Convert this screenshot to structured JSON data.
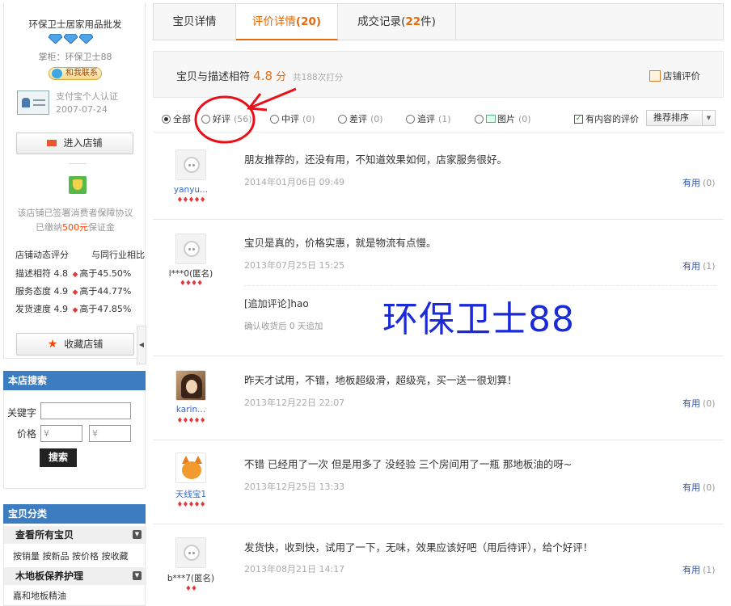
{
  "shop": {
    "name": "环保卫士居家用品批发",
    "keeper": "掌柜：环保卫士88",
    "contact": "和我联系",
    "cert_line1": "支付宝个人认证",
    "cert_line2": "2007-07-24",
    "enter_button": "进入店铺",
    "protect_line1": "该店铺已签署消费者保障协议",
    "protect_line2_prefix": "已缴纳",
    "protect_amount": "500元",
    "protect_line2_suffix": "保证金",
    "dsr_title": "店铺动态评分",
    "dsr_compare": "与同行业相比",
    "dsr": [
      {
        "label": "描述相符",
        "score": "4.8",
        "compare": "高于45.50%"
      },
      {
        "label": "服务态度",
        "score": "4.9",
        "compare": "高于44.77%"
      },
      {
        "label": "发货速度",
        "score": "4.9",
        "compare": "高于47.85%"
      }
    ],
    "favorite_button": "收藏店铺"
  },
  "search": {
    "title": "本店搜索",
    "keyword_label": "关键字",
    "price_label": "价格",
    "price_placeholder": "¥",
    "button": "搜索"
  },
  "categories": {
    "title": "宝贝分类",
    "all_items": "查看所有宝贝",
    "sort_links": "按销量 按新品 按价格 按收藏",
    "floor_care": "木地板保养护理",
    "floor_oil": "嘉和地板精油"
  },
  "tabs": [
    {
      "label": "宝贝详情",
      "count": ""
    },
    {
      "label": "评价详情",
      "count": "(20)"
    },
    {
      "label": "成交记录",
      "count_prefix": "(",
      "count": "22",
      "count_suffix": "件)"
    }
  ],
  "summary": {
    "label": "宝贝与描述相符",
    "score": "4.8",
    "unit": "分",
    "total": "共188次打分",
    "shop_rating": "店铺评价"
  },
  "filters": [
    {
      "label": "全部",
      "count": ""
    },
    {
      "label": "好评",
      "count": "(56)"
    },
    {
      "label": "中评",
      "count": "(0)"
    },
    {
      "label": "差评",
      "count": "(0)"
    },
    {
      "label": "追评",
      "count": "(1)"
    },
    {
      "label": "图片",
      "count": "(0)"
    }
  ],
  "has_content_label": "有内容的评价",
  "sort_option": "推荐排序",
  "useful_label": "有用",
  "reviews": [
    {
      "user": "yanyu...",
      "hearts": "♦♦♦♦♦",
      "text": "朋友推荐的，还没有用，不知道效果如何，店家服务很好。",
      "date": "2014年01月06日 09:49",
      "useful": "(0)"
    },
    {
      "user": "l***0(匿名)",
      "hearts": "♦♦♦♦",
      "text": "宝贝是真的，价格实惠，就是物流有点慢。",
      "date": "2013年07月25日 15:25",
      "useful": "(1)",
      "append_text": "[追加评论]hao",
      "append_meta": "确认收货后 0 天追加"
    },
    {
      "user": "karin...",
      "hearts": "♦♦♦♦♦",
      "text": "昨天才试用，不错，地板超级滑，超级亮，买一送一很划算！",
      "date": "2013年12月22日 22:07",
      "useful": "(0)"
    },
    {
      "user": "天线宝1",
      "hearts": "♦♦♦♦♦",
      "text": "不错 已经用了一次 但是用多了 没经验 三个房间用了一瓶 那地板油的呀~",
      "date": "2013年12月25日 13:33",
      "useful": "(0)"
    },
    {
      "user": "b***7(匿名)",
      "hearts": "♦♦",
      "text": "发货快，收到快，试用了一下，无味，效果应该好吧（用后待评），给个好评！",
      "date": "2013年08月21日 14:17",
      "useful": "(1)"
    }
  ],
  "watermark": "环保卫士88",
  "colors": {
    "accent": "#e56a0c",
    "link": "#3355aa",
    "panel": "#3c7dc2",
    "annotation": "#e8101a"
  }
}
